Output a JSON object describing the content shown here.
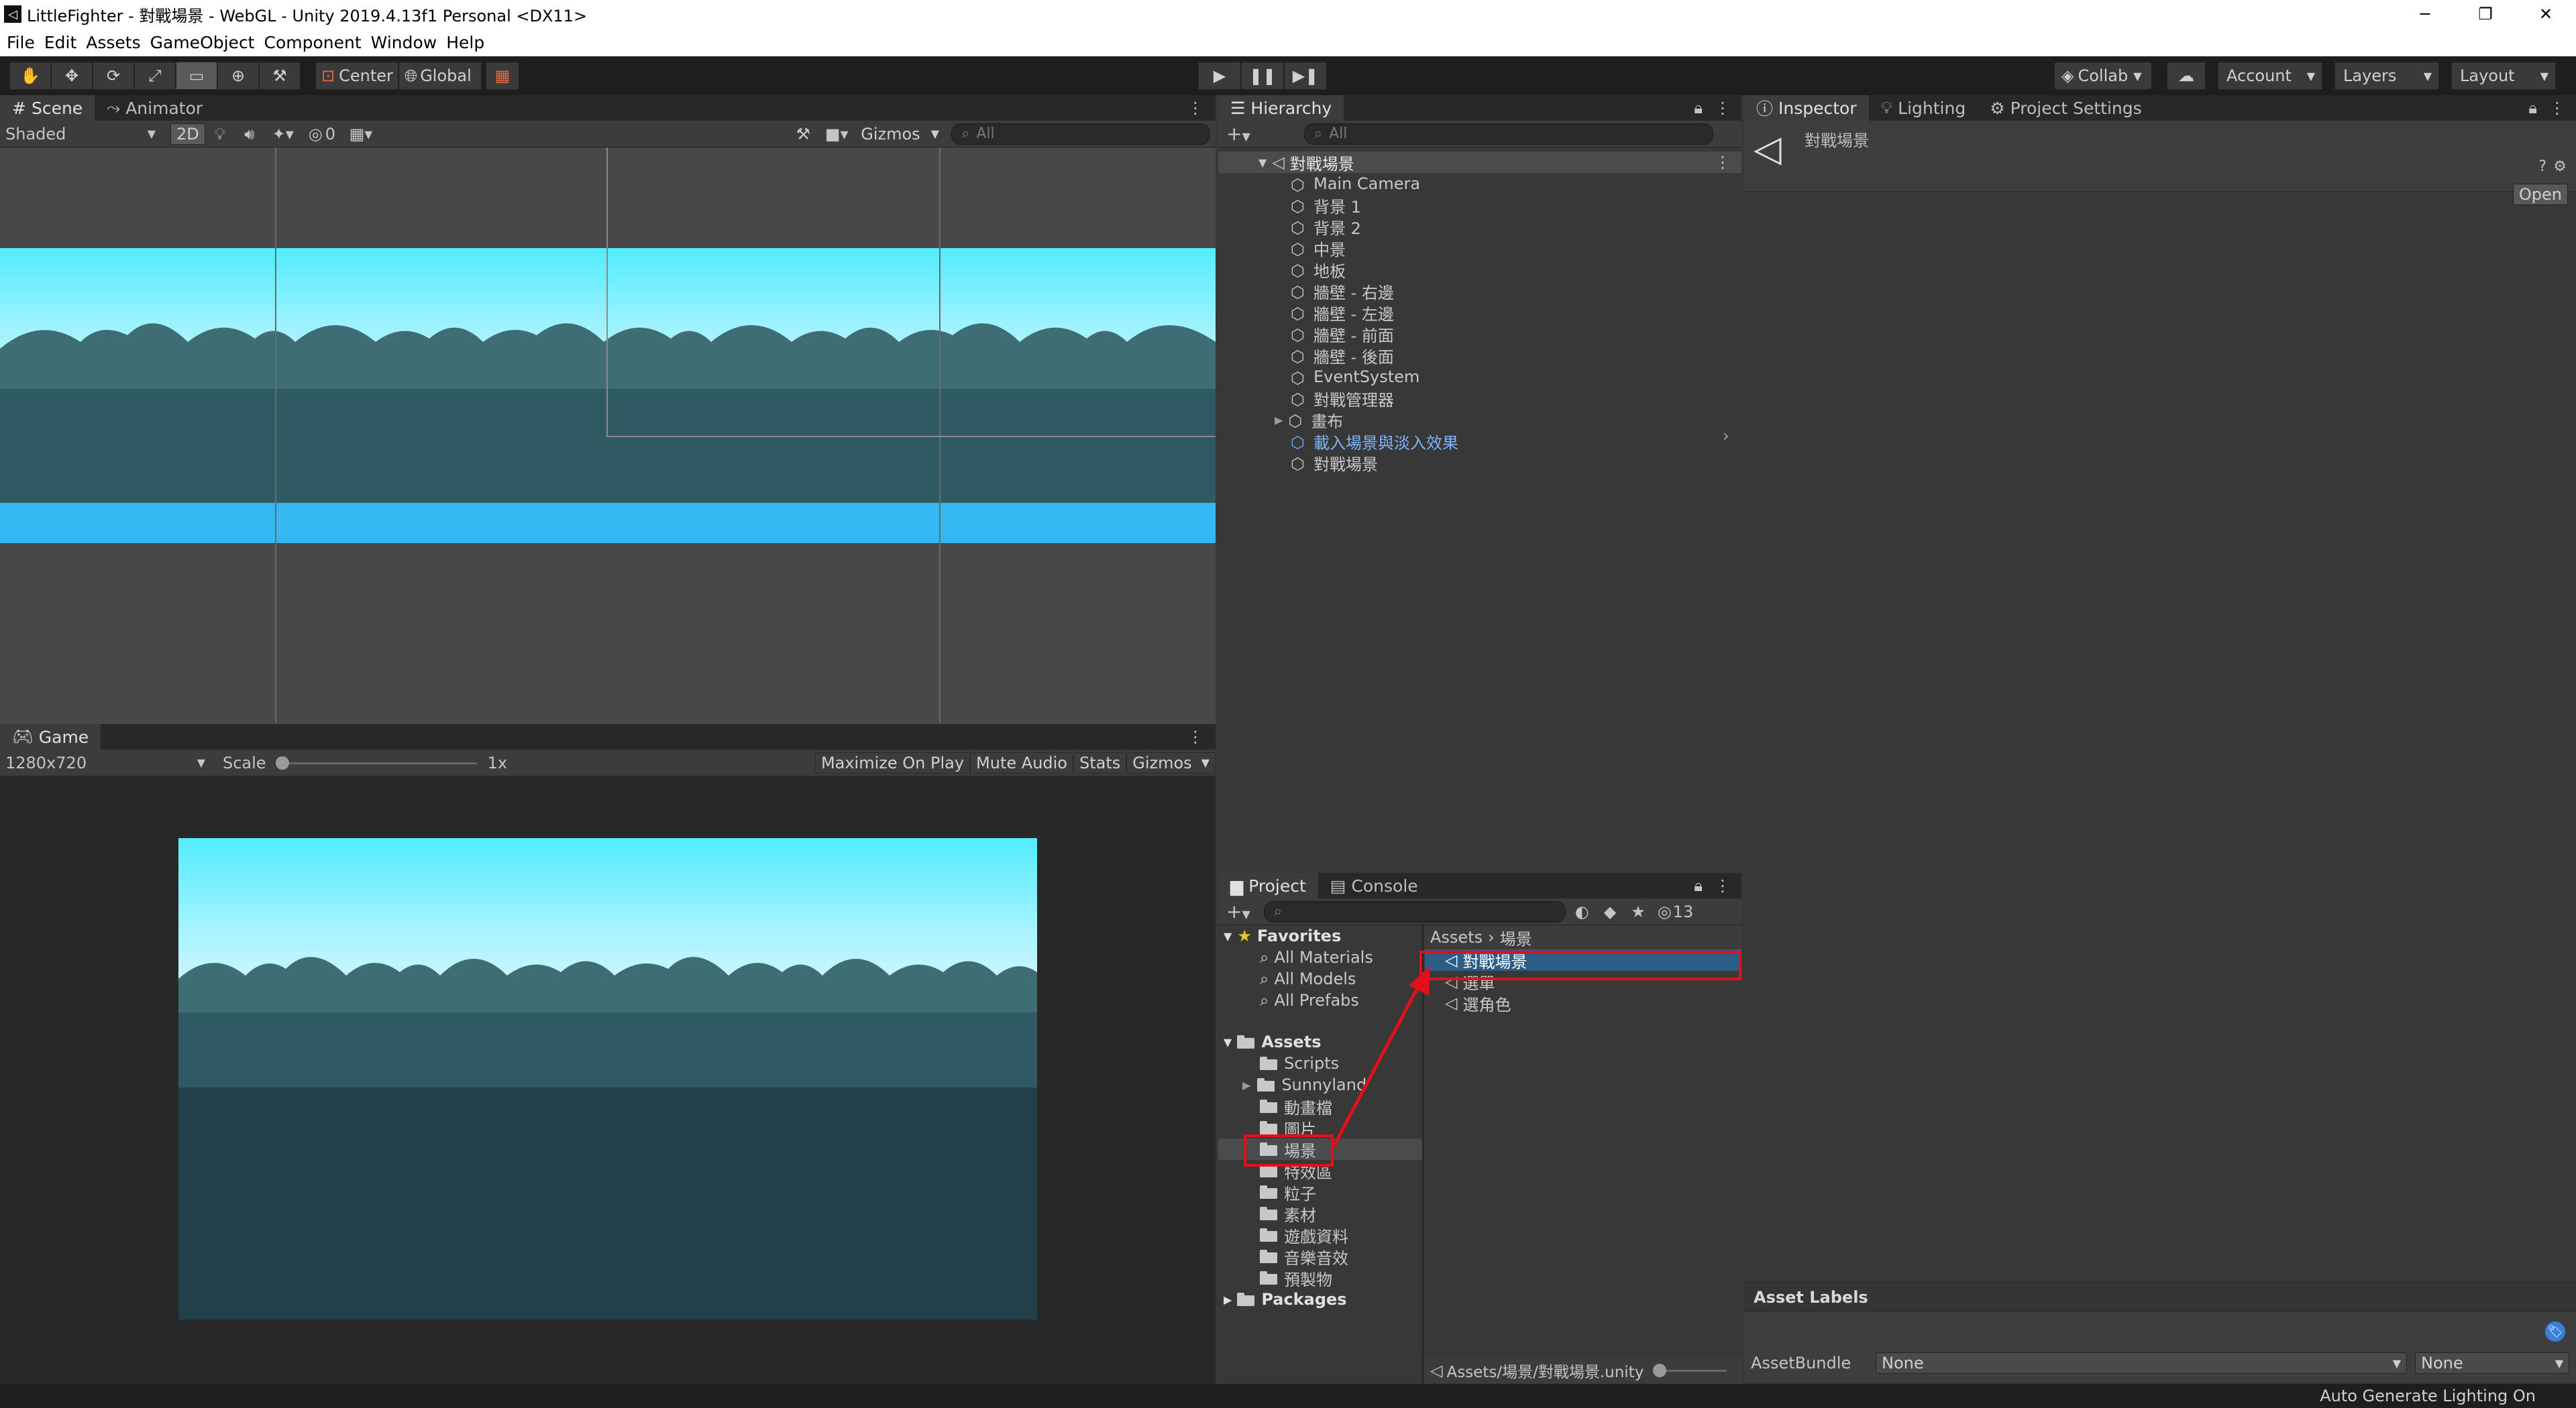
{
  "window": {
    "title": "LittleFighter - 對戰場景 - WebGL - Unity 2019.4.13f1 Personal <DX11>",
    "controls": [
      "─",
      "❐",
      "✕"
    ]
  },
  "menu": [
    "File",
    "Edit",
    "Assets",
    "GameObject",
    "Component",
    "Window",
    "Help"
  ],
  "toolbar": {
    "pivot": "Center",
    "space": "Global",
    "collab": "Collab",
    "account": "Account",
    "layers": "Layers",
    "layout": "Layout"
  },
  "scene_panel": {
    "tabs": [
      "Scene",
      "Animator"
    ],
    "shading": "Shaded",
    "mode_2d": "2D",
    "hidden_count": "0",
    "gizmos": "Gizmos",
    "search_placeholder": "All"
  },
  "game_panel": {
    "tab": "Game",
    "resolution": "1280x720",
    "scale_label": "Scale",
    "scale_value": "1x",
    "scale_level": 0.0,
    "options": [
      "Maximize On Play",
      "Mute Audio",
      "Stats",
      "Gizmos"
    ]
  },
  "hierarchy": {
    "tab": "Hierarchy",
    "search_placeholder": "All",
    "scene": "對戰場景",
    "items": [
      {
        "label": "Main Camera",
        "prefab": false,
        "arrow": false
      },
      {
        "label": "背景 1",
        "prefab": false,
        "arrow": false
      },
      {
        "label": "背景 2",
        "prefab": false,
        "arrow": false
      },
      {
        "label": "中景",
        "prefab": false,
        "arrow": false
      },
      {
        "label": "地板",
        "prefab": false,
        "arrow": false
      },
      {
        "label": "牆壁 - 右邊",
        "prefab": false,
        "arrow": false
      },
      {
        "label": "牆壁 - 左邊",
        "prefab": false,
        "arrow": false
      },
      {
        "label": "牆壁 - 前面",
        "prefab": false,
        "arrow": false
      },
      {
        "label": "牆壁 - 後面",
        "prefab": false,
        "arrow": false
      },
      {
        "label": "EventSystem",
        "prefab": false,
        "arrow": false
      },
      {
        "label": "對戰管理器",
        "prefab": false,
        "arrow": false
      },
      {
        "label": "畫布",
        "prefab": false,
        "arrow": true
      },
      {
        "label": "載入場景與淡入效果",
        "prefab": true,
        "arrow": false
      },
      {
        "label": "對戰場景",
        "prefab": false,
        "arrow": false
      }
    ]
  },
  "project": {
    "tabs": [
      "Project",
      "Console"
    ],
    "hidden_count": "13",
    "favorites_label": "Favorites",
    "favorites": [
      "All Materials",
      "All Models",
      "All Prefabs"
    ],
    "assets_label": "Assets",
    "folders": [
      {
        "label": "Scripts",
        "arrow": false
      },
      {
        "label": "Sunnyland",
        "arrow": true
      },
      {
        "label": "動畫檔",
        "arrow": false
      },
      {
        "label": "圖片",
        "arrow": false
      },
      {
        "label": "場景",
        "arrow": false,
        "selected": true
      },
      {
        "label": "特效區",
        "arrow": false
      },
      {
        "label": "粒子",
        "arrow": false
      },
      {
        "label": "素材",
        "arrow": false
      },
      {
        "label": "遊戲資料",
        "arrow": false
      },
      {
        "label": "音樂音效",
        "arrow": false
      },
      {
        "label": "預製物",
        "arrow": false
      }
    ],
    "packages_label": "Packages",
    "breadcrumb": [
      "Assets",
      "場景"
    ],
    "files": [
      "對戰場景",
      "選單",
      "選角色"
    ],
    "selected_file": "對戰場景",
    "footer_path": "Assets/場景/對戰場景.unity"
  },
  "inspector": {
    "tabs": [
      "Inspector",
      "Lighting",
      "Project Settings"
    ],
    "asset_name": "對戰場景",
    "open_button": "Open",
    "asset_labels": "Asset Labels",
    "assetbundle_label": "AssetBundle",
    "assetbundle_value": "None",
    "variant_value": "None"
  },
  "statusbar": {
    "text": "Auto Generate Lighting On"
  },
  "colors": {
    "annotation_red": "#e3101c",
    "selection_blue": "#2c5d87",
    "sky": "#4ce6ff",
    "water_band": "#35b8f2"
  }
}
